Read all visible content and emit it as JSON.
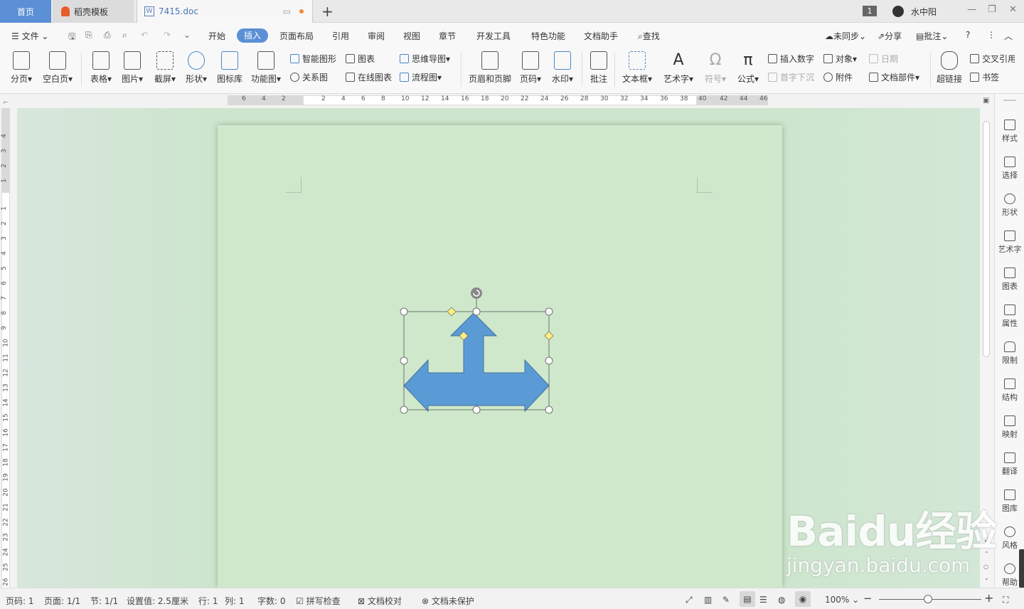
{
  "tabs": {
    "home": "首页",
    "daoke": "稻壳模板",
    "doc": "7415.doc",
    "window_count": "1",
    "user": "水中阳"
  },
  "menu": {
    "file": "文件",
    "items": [
      "开始",
      "插入",
      "页面布局",
      "引用",
      "审阅",
      "视图",
      "章节",
      "开发工具",
      "特色功能",
      "文档助手"
    ],
    "active": "插入",
    "search": "查找",
    "sync": "未同步",
    "share": "分享",
    "comment": "批注"
  },
  "tools": {
    "page_break": "分页",
    "blank_page": "空白页",
    "table": "表格",
    "picture": "图片",
    "screenshot": "截屏",
    "shape": "形状",
    "icon_lib": "图标库",
    "func_chart": "功能图",
    "smart_art": "智能图形",
    "chart": "图表",
    "mind_map": "思维导图",
    "relation": "关系图",
    "online_chart": "在线图表",
    "flowchart": "流程图",
    "header_footer": "页眉和页脚",
    "page_num": "页码",
    "watermark": "水印",
    "annotate": "批注",
    "textbox": "文本框",
    "wordart": "艺术字",
    "symbol": "符号",
    "formula": "公式",
    "insert_num": "插入数字",
    "object": "对象",
    "date": "日期",
    "drop_cap": "首字下沉",
    "attachment": "附件",
    "doc_parts": "文档部件",
    "hyperlink": "超链接",
    "cross_ref": "交叉引用",
    "bookmark": "书签"
  },
  "ruler_h": [
    "6",
    "4",
    "2",
    "2",
    "4",
    "6",
    "8",
    "10",
    "12",
    "14",
    "16",
    "18",
    "20",
    "22",
    "24",
    "26",
    "28",
    "30",
    "32",
    "34",
    "36",
    "38",
    "40",
    "42",
    "44",
    "46"
  ],
  "ruler_v": [
    "4",
    "3",
    "2",
    "1",
    "1",
    "2",
    "3",
    "4",
    "5",
    "6",
    "7",
    "8",
    "9",
    "10",
    "11",
    "12",
    "13",
    "14",
    "15",
    "16",
    "17",
    "18",
    "19",
    "20",
    "21",
    "22",
    "23",
    "24",
    "25",
    "26"
  ],
  "right_panel": [
    "样式",
    "选择",
    "形状",
    "艺术字",
    "图表",
    "属性",
    "限制",
    "结构",
    "映射",
    "翻译",
    "图库",
    "风格",
    "帮助"
  ],
  "status": {
    "page_num": "页码: 1",
    "page": "页面: 1/1",
    "section": "节: 1/1",
    "setting": "设置值: 2.5厘米",
    "row": "行: 1",
    "col": "列: 1",
    "word_count": "字数: 0",
    "spell": "拼写检查",
    "proof": "文档校对",
    "protect": "文档未保护",
    "zoom": "100%"
  },
  "shape": {
    "fill": "#5b9bd5",
    "stroke": "#41719c",
    "name": "up-left-right-arrow"
  },
  "watermark": {
    "big": "Baidu经验",
    "small": "jingyan.baidu.com"
  }
}
